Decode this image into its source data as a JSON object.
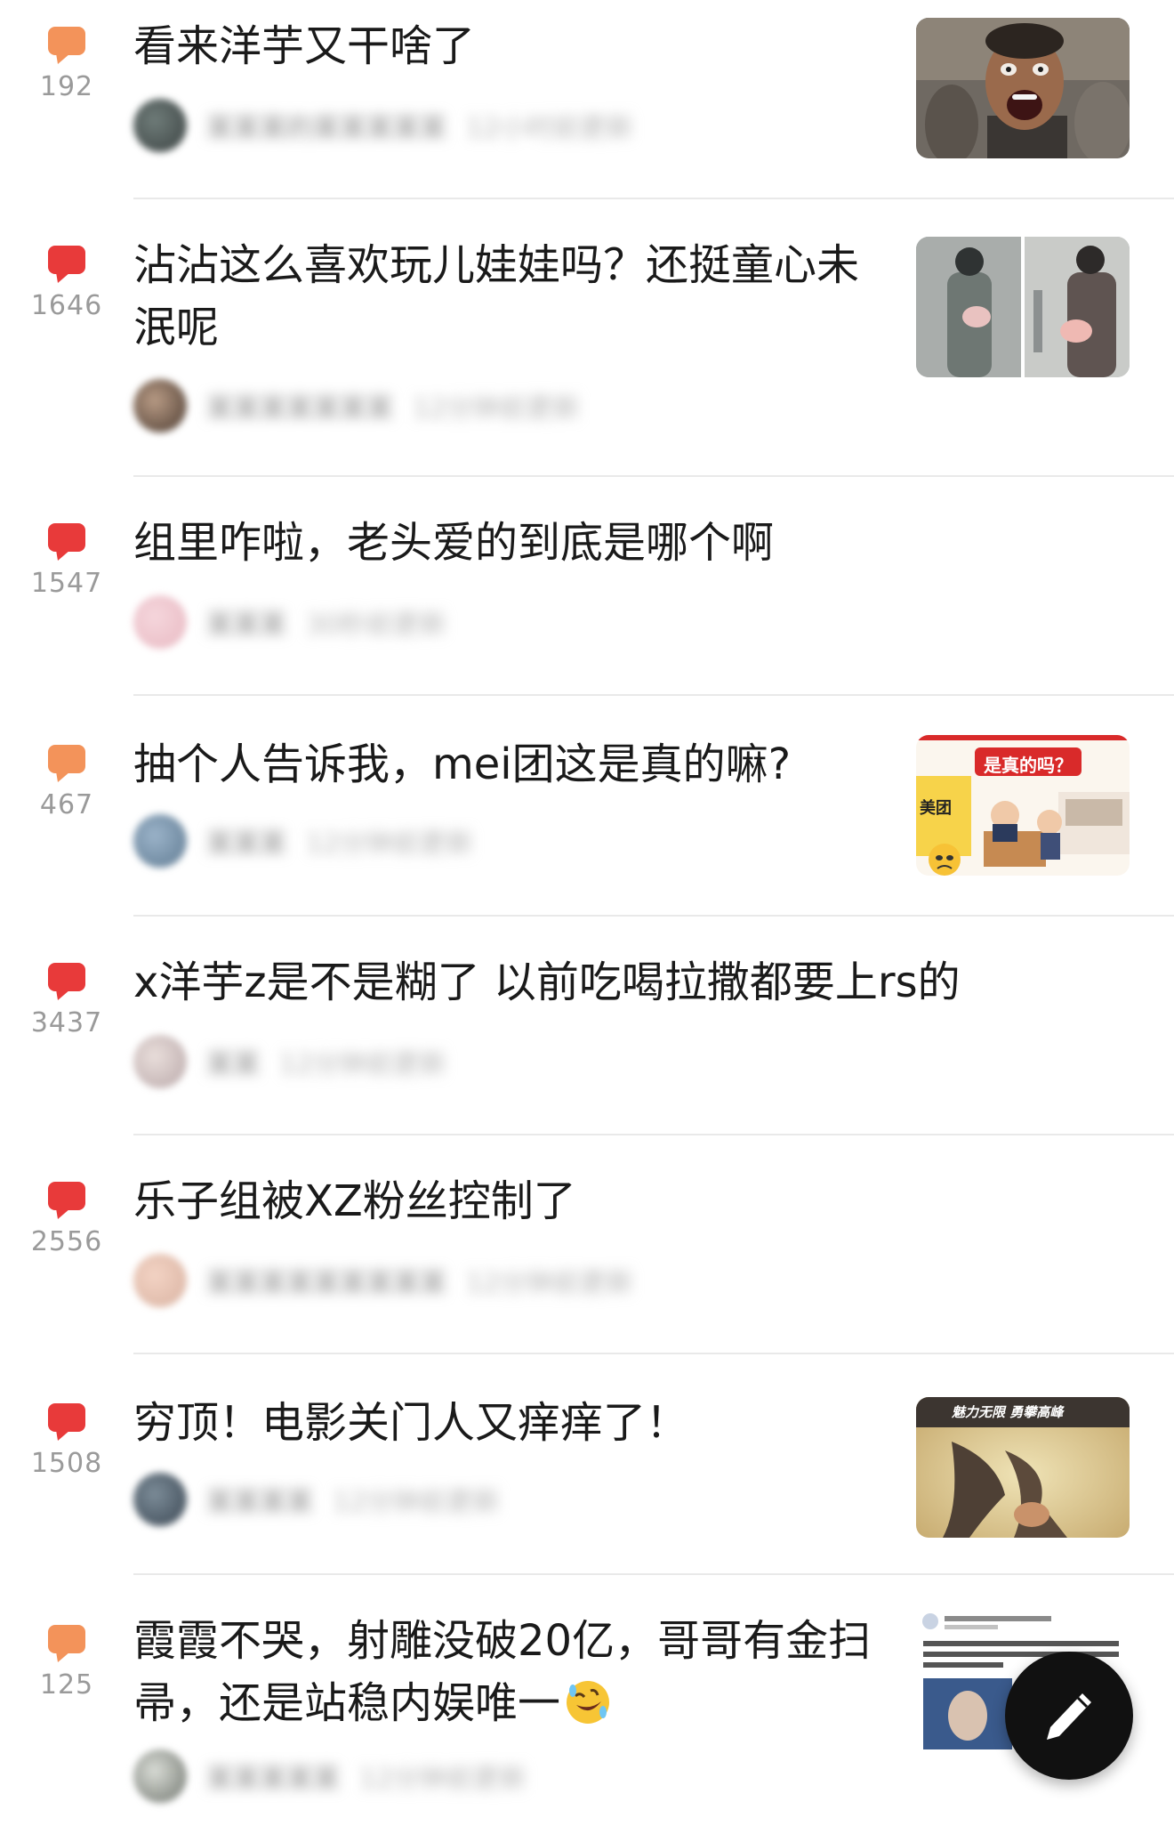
{
  "colors": {
    "bubble_orange": "#f3935a",
    "bubble_red": "#e83a3a",
    "divider": "#e9e9e9",
    "fab": "#111111"
  },
  "posts": [
    {
      "replies": "192",
      "bubble": "orange",
      "title": "看来洋芋又干啥了",
      "author": "某某某的某某某某某",
      "time": "12小时前更新",
      "thumb_icon": "shocked-man-photo"
    },
    {
      "replies": "1646",
      "bubble": "red",
      "title": "沾沾这么喜欢玩儿娃娃吗？还挺童心未泯呢",
      "author": "某某某某某某某",
      "time": "12分钟前更新",
      "thumb_icon": "airport-doll-photo"
    },
    {
      "replies": "1547",
      "bubble": "red",
      "title": "组里咋啦，老头爱的到底是哪个啊",
      "author": "某某某",
      "time": "30秒前更新",
      "thumb_icon": ""
    },
    {
      "replies": "467",
      "bubble": "orange",
      "title": "抽个人告诉我，mei团这是真的嘛?",
      "author": "某某某",
      "time": "12分钟前更新",
      "thumb_icon": "meituan-cartoon-image",
      "thumb_caption": "是真的吗？",
      "thumb_brand": "美团"
    },
    {
      "replies": "3437",
      "bubble": "red",
      "title": "x洋芋z是不是糊了 以前吃喝拉撒都要上rs的",
      "author": "某某",
      "time": "12分钟前更新",
      "thumb_icon": ""
    },
    {
      "replies": "2556",
      "bubble": "red",
      "title": "乐子组被XZ粉丝控制了",
      "author": "某某某某某某某某某",
      "time": "12分钟前更新",
      "thumb_icon": ""
    },
    {
      "replies": "1508",
      "bubble": "red",
      "title": "穷顶！电影关门人又痒痒了！",
      "author": "某某某某",
      "time": "12分钟前更新",
      "thumb_icon": "movie-poster-image",
      "thumb_caption": "魅力无限  勇攀高峰"
    },
    {
      "replies": "125",
      "bubble": "orange",
      "title": "霞霞不哭，射雕没破20亿，哥哥有金扫帚，还是站稳内娱唯一",
      "author": "某某某某某",
      "time": "12分钟前更新",
      "thumb_icon": "weibo-screenshot-image",
      "title_emoji": "rolling-laughing-emoji"
    }
  ],
  "fab": {
    "icon": "pencil-icon"
  }
}
